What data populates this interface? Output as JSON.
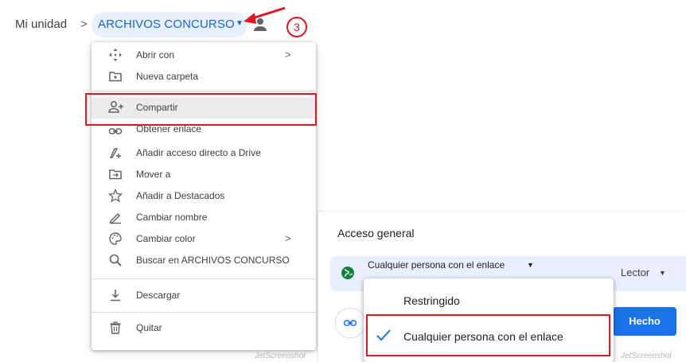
{
  "breadcrumb": {
    "root": "Mi unidad",
    "separator": ">",
    "current": "ARCHIVOS CONCURSO"
  },
  "annotation": {
    "step": "3"
  },
  "menu": {
    "items": [
      {
        "label": "Abrir con",
        "icon": "open-with-icon",
        "submenu": true
      },
      {
        "label": "Nueva carpeta",
        "icon": "new-folder-icon"
      },
      {
        "label": "Compartir",
        "icon": "add-person-icon"
      },
      {
        "label": "Obtener enlace",
        "icon": "link-icon"
      },
      {
        "label": "Añadir acceso directo a Drive",
        "icon": "add-shortcut-icon"
      },
      {
        "label": "Mover a",
        "icon": "move-to-icon"
      },
      {
        "label": "Añadir a Destacados",
        "icon": "star-icon"
      },
      {
        "label": "Cambiar nombre",
        "icon": "rename-icon"
      },
      {
        "label": "Cambiar color",
        "icon": "palette-icon",
        "submenu": true
      },
      {
        "label": "Buscar en ARCHIVOS CONCURSO",
        "icon": "search-icon"
      },
      {
        "label": "Descargar",
        "icon": "download-icon"
      },
      {
        "label": "Quitar",
        "icon": "trash-icon"
      }
    ],
    "submenu_glyph": ">"
  },
  "share_dialog": {
    "general_access_title": "Acceso general",
    "access_level": "Cualquier persona con el enlace",
    "role": "Lector",
    "done_button": "Hecho",
    "dropdown_options": [
      "Restringido",
      "Cualquier persona con el enlace"
    ],
    "selected_option_index": 1
  },
  "watermarks": {
    "left": "JetScreenshot",
    "right": "JetScreenshot"
  },
  "colors": {
    "accent": "#1a73e8",
    "annotation_red": "#e0161d",
    "chip_bg": "#e8f0fe",
    "globe_green": "#188038"
  }
}
